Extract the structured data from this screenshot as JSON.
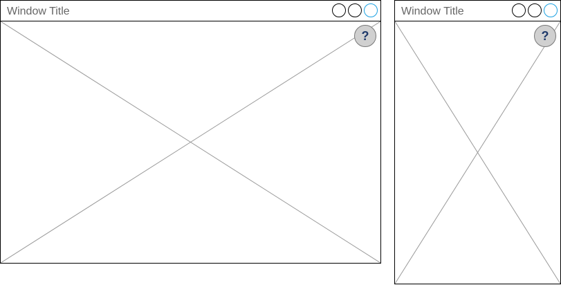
{
  "windows": [
    {
      "title": "Window Title",
      "controls": {
        "minimize_icon": "circle-outline",
        "maximize_icon": "circle-outline",
        "close_icon": "circle-outline-blue"
      },
      "help": {
        "label": "?",
        "icon": "help-icon"
      }
    },
    {
      "title": "Window Title",
      "controls": {
        "minimize_icon": "circle-outline",
        "maximize_icon": "circle-outline",
        "close_icon": "circle-outline-blue"
      },
      "help": {
        "label": "?",
        "icon": "help-icon"
      }
    }
  ],
  "colors": {
    "border": "#000000",
    "title_text": "#666666",
    "close_accent": "#1ba1e2",
    "placeholder_lines": "#999999",
    "help_bg": "#d0d0d0",
    "help_text": "#1f3a6b"
  }
}
